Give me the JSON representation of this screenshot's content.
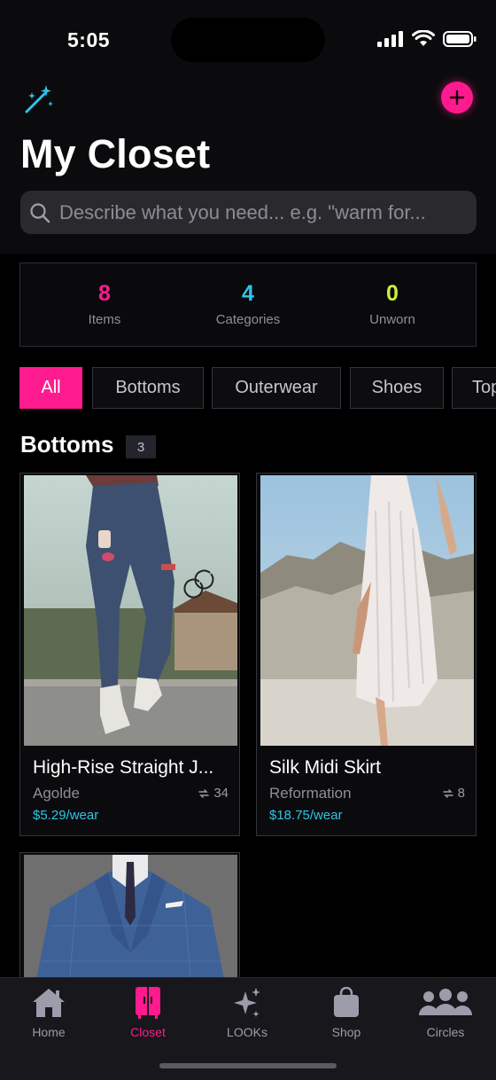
{
  "status": {
    "time": "5:05"
  },
  "header": {
    "title": "My Closet"
  },
  "search": {
    "placeholder": "Describe what you need... e.g. \"warm for..."
  },
  "stats": [
    {
      "value": "8",
      "label": "Items",
      "color": "#ff1a8f"
    },
    {
      "value": "4",
      "label": "Categories",
      "color": "#2ec4e6"
    },
    {
      "value": "0",
      "label": "Unworn",
      "color": "#c8f03c"
    }
  ],
  "filters": [
    "All",
    "Bottoms",
    "Outerwear",
    "Shoes",
    "Top"
  ],
  "active_filter": "All",
  "section": {
    "title": "Bottoms",
    "count": "3"
  },
  "items": [
    {
      "title": "High-Rise Straight J...",
      "brand": "Agolde",
      "wears": "34",
      "cost_per_wear": "$5.29/wear"
    },
    {
      "title": "Silk Midi Skirt",
      "brand": "Reformation",
      "wears": "8",
      "cost_per_wear": "$18.75/wear"
    }
  ],
  "tabs": [
    {
      "label": "Home",
      "icon": "home-icon"
    },
    {
      "label": "Closet",
      "icon": "closet-icon"
    },
    {
      "label": "LOOKs",
      "icon": "sparkles-icon"
    },
    {
      "label": "Shop",
      "icon": "shopping-bag-icon"
    },
    {
      "label": "Circles",
      "icon": "people-icon"
    }
  ],
  "active_tab": "Closet",
  "colors": {
    "accent": "#ff1a8f",
    "cyan": "#2ec4e6",
    "lime": "#c8f03c",
    "background": "#000000"
  }
}
